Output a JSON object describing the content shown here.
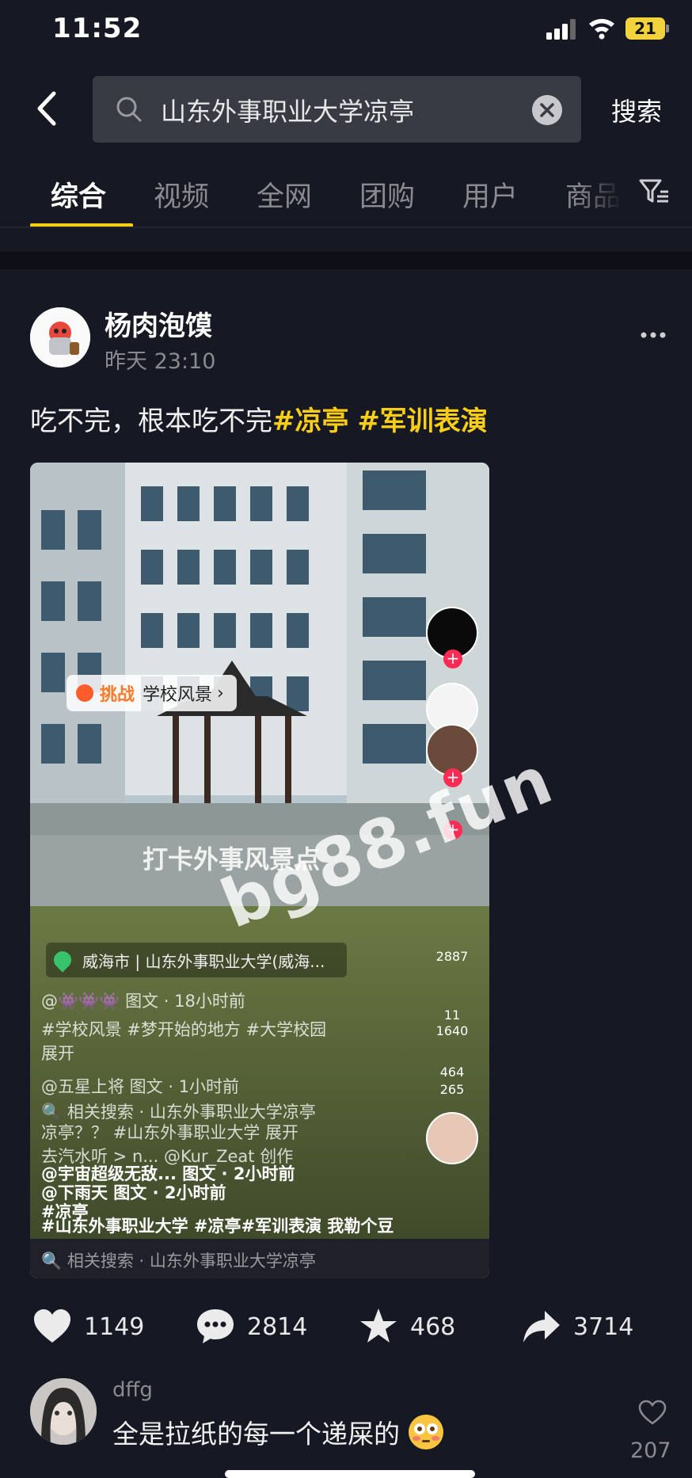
{
  "status_bar": {
    "time": "11:52",
    "battery": "21"
  },
  "search": {
    "query": "山东外事职业大学凉亭",
    "button_label": "搜索"
  },
  "tabs": [
    "综合",
    "视频",
    "全网",
    "团购",
    "用户",
    "商品"
  ],
  "active_tab": "综合",
  "post": {
    "author": "杨肉泡馍",
    "time": "昨天 23:10",
    "caption_text": "吃不完，根本吃不完",
    "hashtags": [
      "#凉亭",
      "#军训表演"
    ],
    "video": {
      "challenge_label": "挑战",
      "challenge_topic": "学校风景",
      "overlay_text": "打卡外事风景点",
      "location": "威海市 | 山东外事职业大学(威海...",
      "lines": [
        "@👾👾👾 图文 · 18小时前",
        "#学校风景 #梦开始的地方 #大学校园",
        "展开",
        "@五星上将  图文 · 1小时前",
        "🔍 相关搜索 · 山东外事职业大学凉亭",
        "凉亭？？ #山东外事职业大学  展开",
        "去汽水听 > n... @Kur_Zeat 创作",
        "@宇宙超级无敌...  图文 · 2小时前",
        "@下雨天  图文 · 2小时前",
        "#凉亭",
        "#山东外事职业大学 #凉亭#军训表演  我勒个豆"
      ],
      "bottom_line": "🔍 相关搜索 · 山东外事职业大学凉亭",
      "rail_counts": [
        "2887",
        "11",
        "1640",
        "464",
        "265"
      ]
    },
    "actions": {
      "likes": "1149",
      "comments": "2814",
      "favorites": "468",
      "shares": "3714"
    }
  },
  "watermark": "bg88.fun",
  "comment": {
    "user": "dffg",
    "text": "全是拉纸的每一个递屎的",
    "likes": "207"
  },
  "colors": {
    "background": "#161823",
    "accent": "#face15",
    "search_bg": "#393b44",
    "muted": "#8a8b91",
    "plus_badge": "#fe2c55"
  }
}
